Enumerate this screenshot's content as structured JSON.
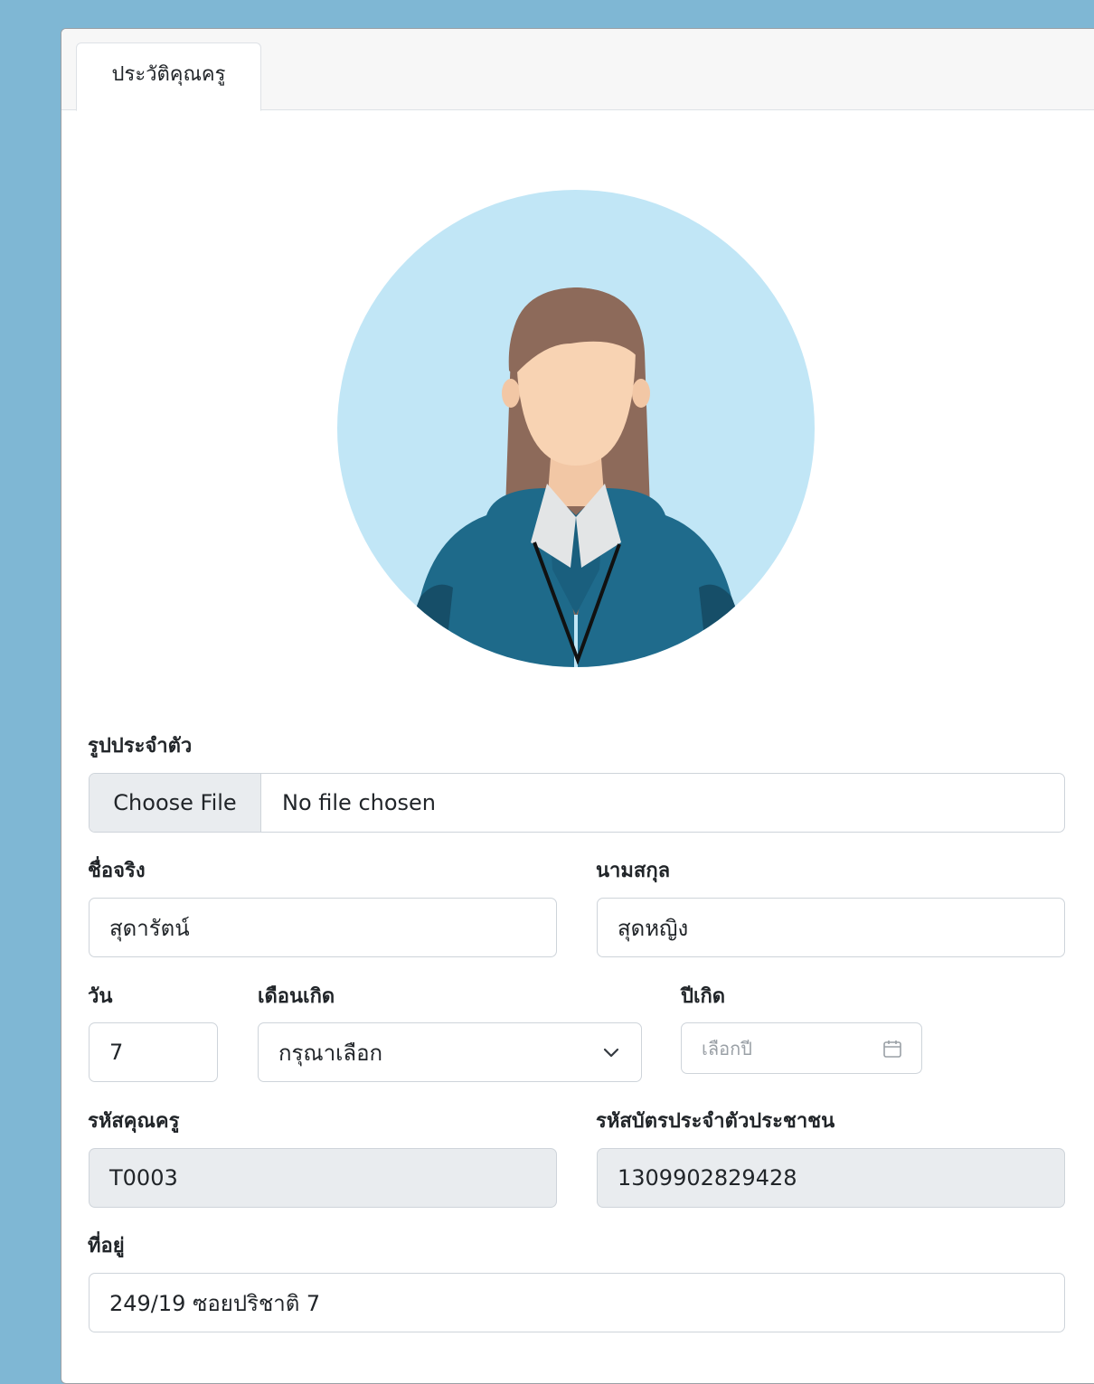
{
  "tab": {
    "label": "ประวัติคุณครู"
  },
  "profile_photo": {
    "label": "รูปประจำตัว",
    "button_label": "Choose File",
    "status_text": "No file chosen"
  },
  "first_name": {
    "label": "ชื่อจริง",
    "value": "สุดารัตน์"
  },
  "last_name": {
    "label": "นามสกุล",
    "value": "สุดหญิง"
  },
  "birth_day": {
    "label": "วัน",
    "value": "7"
  },
  "birth_month": {
    "label": "เดือนเกิด",
    "selected": "กรุณาเลือก"
  },
  "birth_year": {
    "label": "ปีเกิด",
    "placeholder": "เลือกปี"
  },
  "teacher_code": {
    "label": "รหัสคุณครู",
    "value": "T0003"
  },
  "national_id": {
    "label": "รหัสบัตรประจำตัวประชาชน",
    "value": "1309902829428"
  },
  "address": {
    "label": "ที่อยู่",
    "value": "249/19 ซอยปริชาติ 7"
  },
  "colors": {
    "page_background": "#7fb7d4",
    "avatar_circle": "#c1e6f6",
    "jacket": "#1e6a8a",
    "hair": "#8d6a5a",
    "skin": "#f8d3b3",
    "readonly_field": "#e9ecef"
  }
}
